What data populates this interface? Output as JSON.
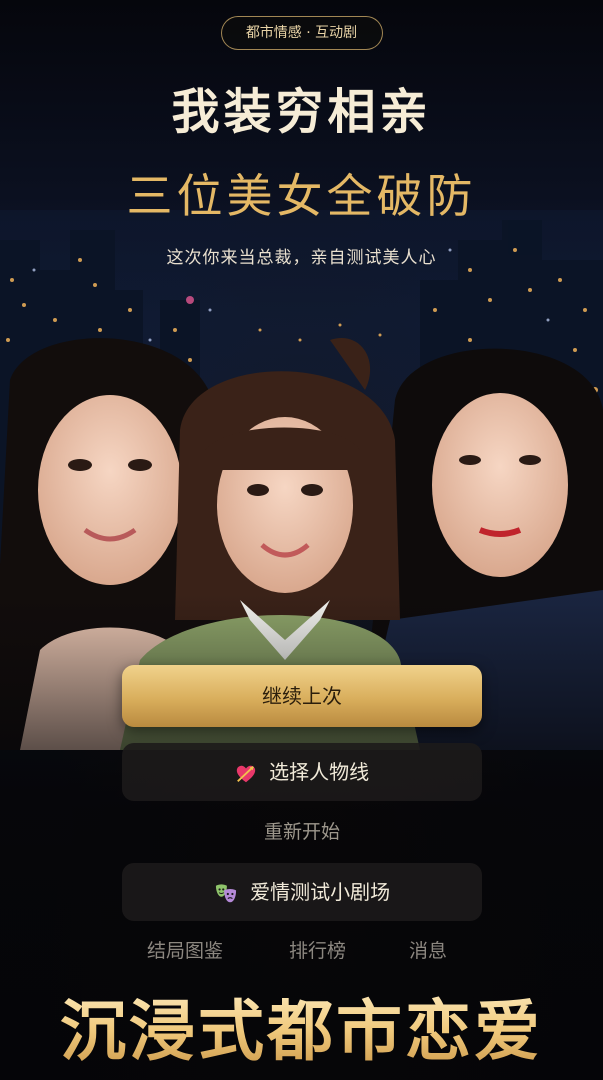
{
  "header": {
    "genre_tag": "都市情感 · 互动剧",
    "title_line1": "我装穷相亲",
    "title_line2": "三位美女全破防",
    "subtitle": "这次你来当总裁，亲自测试美人心"
  },
  "characters": [
    {
      "icon": "heroine-left-portrait"
    },
    {
      "icon": "heroine-center-portrait"
    },
    {
      "icon": "heroine-right-portrait"
    }
  ],
  "menu": {
    "continue_label": "继续上次",
    "select_label": "选择人物线",
    "select_icon": "heart-arrow-icon",
    "restart_label": "重新开始",
    "theater_label": "爱情测试小剧场",
    "theater_icon": "theater-masks-icon"
  },
  "bottom_nav": {
    "endings_label": "结局图鉴",
    "ranking_label": "排行榜",
    "messages_label": "消息"
  },
  "slogan": "沉浸式都市恋爱",
  "colors": {
    "accent_gold": "#e4b865",
    "button_gold": "#d9ae5c",
    "button_dark": "#1c1a1a",
    "background": "#07070d"
  }
}
